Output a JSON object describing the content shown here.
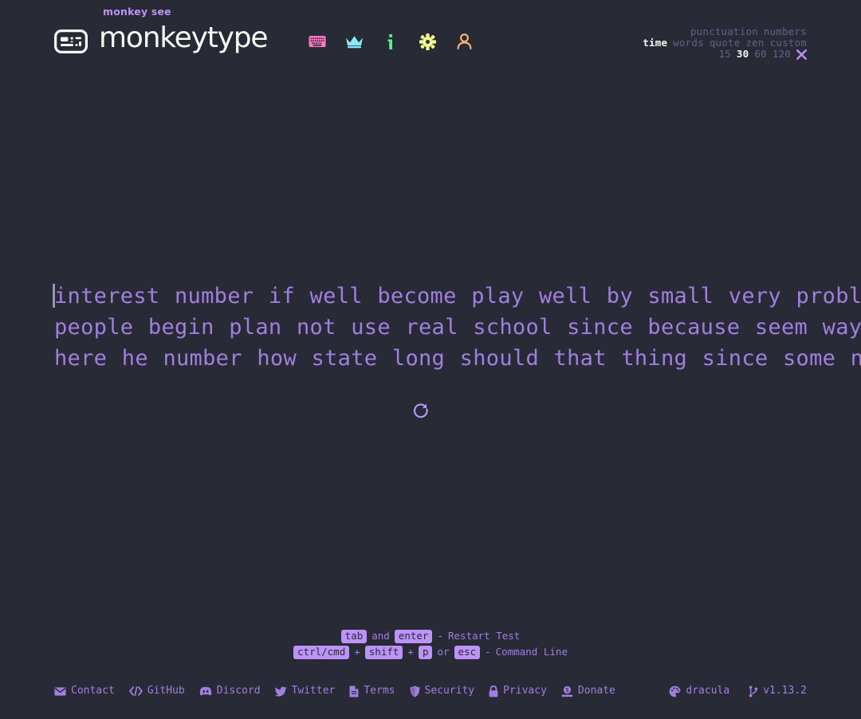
{
  "theme": {
    "background": "#282a36",
    "main_accent": "#bd93f9",
    "text_purple": "#a07fe0",
    "sub_color": "#6a5e8a",
    "bright_text": "#f8f8f2",
    "caret": "#9b94ad"
  },
  "header": {
    "logo_icon": "keyboard-logo-icon",
    "tagline": "monkey see",
    "wordmark": "monkeytype",
    "nav": [
      {
        "name": "nav-keyboard",
        "icon": "keyboard-icon",
        "label": "start test",
        "color": "#ff79c6"
      },
      {
        "name": "nav-leaderboards",
        "icon": "crown-icon",
        "label": "leaderboards",
        "color": "#8be9fd"
      },
      {
        "name": "nav-about",
        "icon": "info-icon",
        "label": "about",
        "color": "#50fa7b"
      },
      {
        "name": "nav-settings",
        "icon": "gear-icon",
        "label": "settings",
        "color": "#f1fa8c"
      },
      {
        "name": "nav-account",
        "icon": "user-icon",
        "label": "account",
        "color": "#ffb86c"
      }
    ]
  },
  "config": {
    "row1": [
      {
        "label": "punctuation",
        "active": false
      },
      {
        "label": "numbers",
        "active": false
      }
    ],
    "row2": [
      {
        "label": "time",
        "active": true
      },
      {
        "label": "words",
        "active": false
      },
      {
        "label": "quote",
        "active": false
      },
      {
        "label": "zen",
        "active": false
      },
      {
        "label": "custom",
        "active": false
      }
    ],
    "row3": [
      {
        "label": "15",
        "active": false
      },
      {
        "label": "30",
        "active": true
      },
      {
        "label": "60",
        "active": false
      },
      {
        "label": "120",
        "active": false
      }
    ],
    "tools_icon": "wrench-icon"
  },
  "test": {
    "caret_position": "before-first-character",
    "lines": [
      "interest number if well become play well by small very problem",
      "people begin plan not use real school since because seem way order",
      "here he number how state long should that thing since some need"
    ],
    "full_text": "interest number if well become play well by small very problem people begin plan not use real school since because seem way order here he number how state long should that thing since some need",
    "restart_icon": "restart-rotate-icon",
    "restart_label": "Restart Test"
  },
  "keyhints": {
    "line1": {
      "key_a": "tab",
      "joiner": "and",
      "key_b": "enter",
      "dash": "-",
      "action": "Restart Test"
    },
    "line2": {
      "key_a": "ctrl/cmd",
      "plus_1": "+",
      "key_b": "shift",
      "plus_2": "+",
      "key_c": "p",
      "joiner": "or",
      "key_d": "esc",
      "dash": "-",
      "action": "Command Line"
    }
  },
  "footer": {
    "left": [
      {
        "label": "Contact",
        "icon": "envelope-icon"
      },
      {
        "label": "GitHub",
        "icon": "code-icon"
      },
      {
        "label": "Discord",
        "icon": "discord-icon"
      },
      {
        "label": "Twitter",
        "icon": "twitter-bird-icon"
      },
      {
        "label": "Terms",
        "icon": "file-icon"
      },
      {
        "label": "Security",
        "icon": "shield-icon"
      },
      {
        "label": "Privacy",
        "icon": "lock-icon"
      },
      {
        "label": "Donate",
        "icon": "donate-icon"
      }
    ],
    "right": [
      {
        "label": "dracula",
        "icon": "palette-icon",
        "name": "theme-switcher"
      },
      {
        "label": "v1.13.2",
        "icon": "code-branch-icon",
        "name": "version-link"
      }
    ]
  }
}
